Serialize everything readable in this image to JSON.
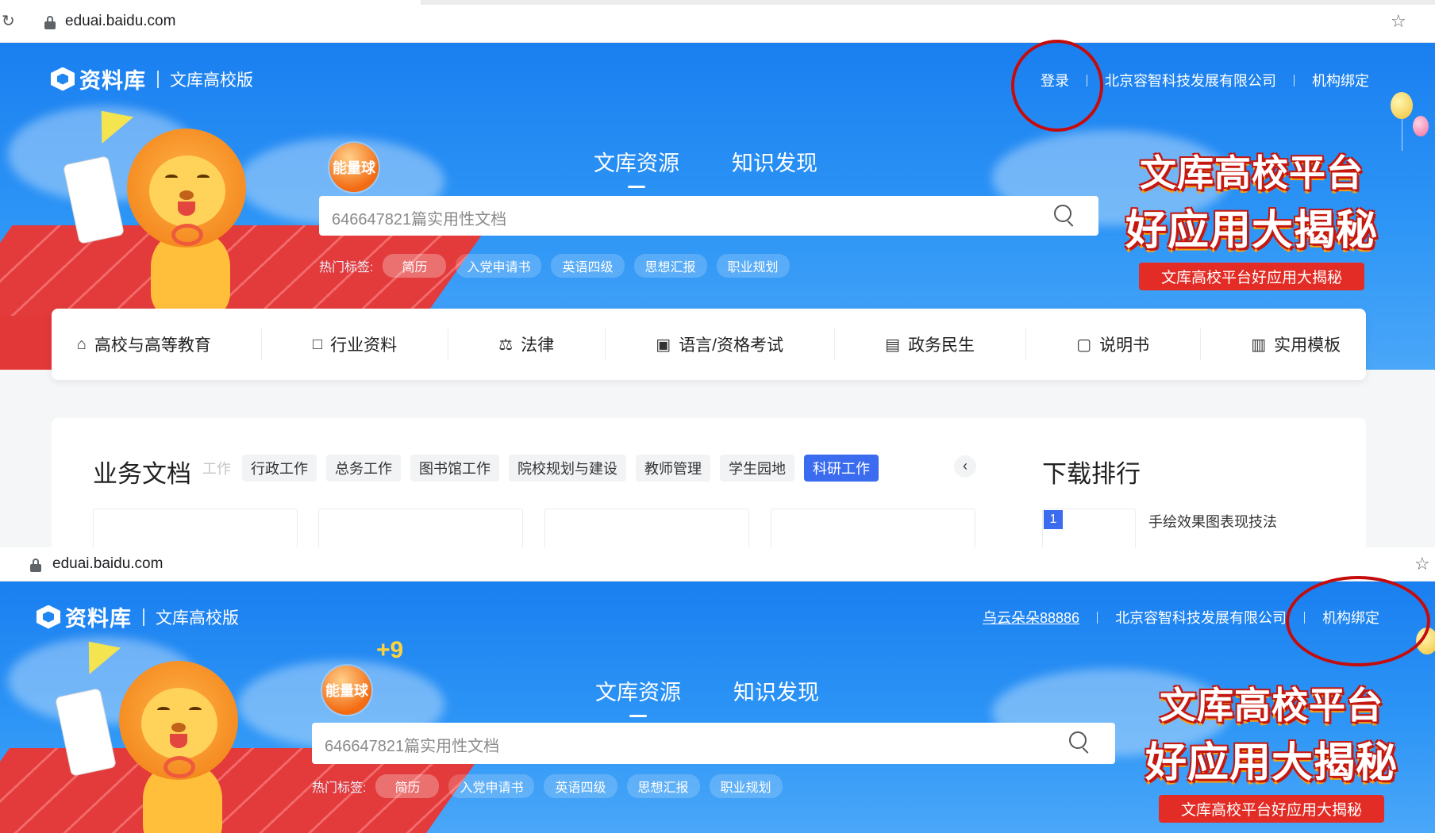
{
  "browser": {
    "url": "eduai.baidu.com"
  },
  "site": {
    "brand": "资料库",
    "sub_brand": "文库高校版",
    "energy_label": "能量球",
    "energy_bonus": "+9"
  },
  "screenshot_before": {
    "nav": {
      "login": "登录",
      "org": "北京容智科技发展有限公司",
      "bind": "机构绑定"
    }
  },
  "screenshot_after": {
    "nav": {
      "username": "乌云朵朵88886",
      "org": "北京容智科技发展有限公司",
      "bind": "机构绑定"
    }
  },
  "main_tabs": [
    "文库资源",
    "知识发现"
  ],
  "search": {
    "placeholder": "646647821篇实用性文档"
  },
  "hot_tags": {
    "label": "热门标签:",
    "tags": [
      "简历",
      "入党申请书",
      "英语四级",
      "思想汇报",
      "职业规划"
    ]
  },
  "promo": {
    "line1": "文库高校平台",
    "line2": "好应用大揭秘",
    "ribbon": "文库高校平台好应用大揭秘"
  },
  "categories": [
    {
      "label": "高校与高等教育",
      "icon": "school-icon"
    },
    {
      "label": "行业资料",
      "icon": "book-icon"
    },
    {
      "label": "法律",
      "icon": "gavel-icon"
    },
    {
      "label": "语言/资格考试",
      "icon": "exam-icon"
    },
    {
      "label": "政务民生",
      "icon": "building-icon"
    },
    {
      "label": "说明书",
      "icon": "manual-icon"
    },
    {
      "label": "实用模板",
      "icon": "template-icon"
    }
  ],
  "business_docs": {
    "title": "业务文档",
    "faded_tag": "工作",
    "tags": [
      "行政工作",
      "总务工作",
      "图书馆工作",
      "院校规划与建设",
      "教师管理",
      "学生园地",
      "科研工作"
    ],
    "active_tag": "科研工作"
  },
  "download_rank": {
    "title": "下载排行",
    "items": [
      {
        "rank": "1",
        "title": "手绘效果图表现技法"
      }
    ]
  },
  "colors": {
    "hero_blue": "#1a7ff0",
    "accent_blue": "#3b6cf0",
    "promo_red": "#e32c25",
    "annotation_red": "#c40c0c"
  }
}
